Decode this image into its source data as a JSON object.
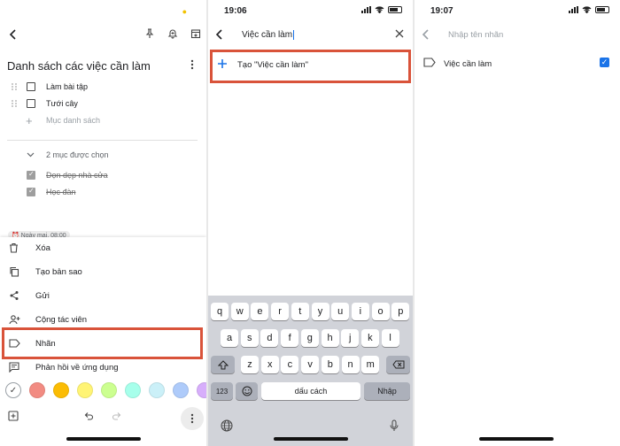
{
  "panel1": {
    "note_title": "Danh sách các việc cần làm",
    "items": [
      {
        "text": "Làm bài tập",
        "checked": false
      },
      {
        "text": "Tưới cây",
        "checked": false
      }
    ],
    "add_item_placeholder": "Mục danh sách",
    "checked_header": "2 mục được chọn",
    "checked_items": [
      {
        "text": "Dọn dẹp nhà cửa",
        "checked": true
      },
      {
        "text": "Học đàn",
        "checked": true
      }
    ],
    "reminder": "Ngày mai, 08:00",
    "menu": {
      "delete": "Xóa",
      "copy": "Tạo bản sao",
      "send": "Gửi",
      "collaborators": "Cộng tác viên",
      "labels": "Nhãn",
      "feedback": "Phản hồi về ứng dụng"
    },
    "colors": [
      "#ffffff",
      "#f28b82",
      "#fbbc04",
      "#fff475",
      "#ccff90",
      "#a7ffeb",
      "#cbf0f8",
      "#aecbfa",
      "#d7aefb"
    ]
  },
  "panel2": {
    "time": "19:06",
    "query": "Việc cần làm",
    "create_label": "Tạo \"Việc cần làm\"",
    "keyboard": {
      "row1": [
        "q",
        "w",
        "e",
        "r",
        "t",
        "y",
        "u",
        "i",
        "o",
        "p"
      ],
      "row2": [
        "a",
        "s",
        "d",
        "f",
        "g",
        "h",
        "j",
        "k",
        "l"
      ],
      "row3": [
        "z",
        "x",
        "c",
        "v",
        "b",
        "n",
        "m"
      ],
      "numbers": "123",
      "space": "dấu cách",
      "enter": "Nhập"
    }
  },
  "panel3": {
    "time": "19:07",
    "placeholder": "Nhập tên nhãn",
    "label_name": "Việc cần làm",
    "label_checked": true
  },
  "accent": "#d9533a",
  "link_blue": "#1a73e8"
}
